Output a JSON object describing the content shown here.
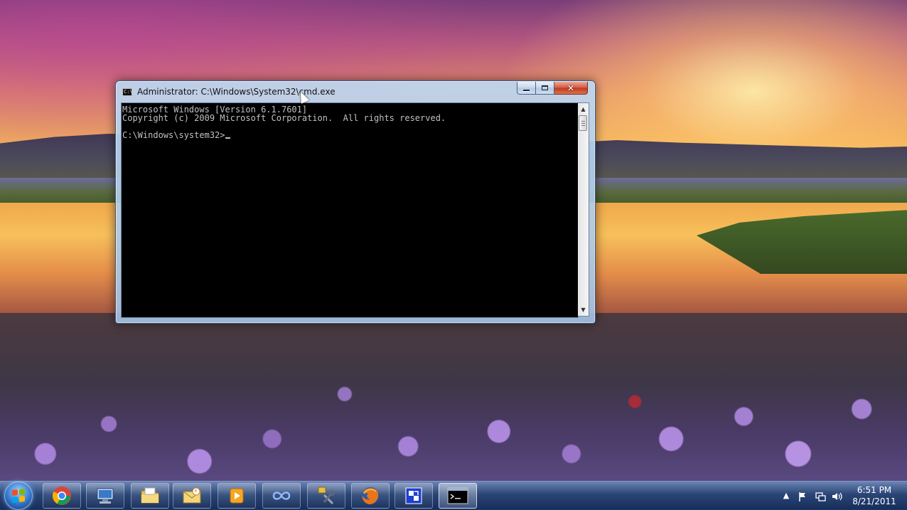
{
  "window": {
    "title": "Administrator: C:\\Windows\\System32\\cmd.exe",
    "icon": "console-icon",
    "icon_text": "C:\\",
    "buttons": {
      "minimize": "minimize-icon",
      "maximize": "maximize-icon",
      "close": "close-icon",
      "close_glyph": "✕"
    },
    "console_lines": [
      "Microsoft Windows [Version 6.1.7601]",
      "Copyright (c) 2009 Microsoft Corporation.  All rights reserved.",
      "",
      "C:\\Windows\\system32>"
    ],
    "colors": {
      "console_bg": "#000000",
      "console_text": "#c0c0c0"
    },
    "scroll": {
      "up": "▲",
      "down": "▼"
    }
  },
  "taskbar": {
    "start": "start-orb",
    "pinned": [
      {
        "name": "chrome-icon"
      },
      {
        "name": "remote-desktop-icon"
      },
      {
        "name": "windows-explorer-icon"
      },
      {
        "name": "mail-icon"
      },
      {
        "name": "media-player-icon"
      },
      {
        "name": "infinity-app-icon"
      },
      {
        "name": "tools-icon"
      },
      {
        "name": "firefox-icon"
      },
      {
        "name": "remote-app-icon"
      },
      {
        "name": "command-prompt-icon"
      }
    ],
    "tray": {
      "show_hidden": "▲",
      "flag": "action-center-icon",
      "network": "network-icon",
      "volume": "volume-icon"
    },
    "clock": {
      "time": "6:51 PM",
      "date": "8/21/2011"
    }
  }
}
